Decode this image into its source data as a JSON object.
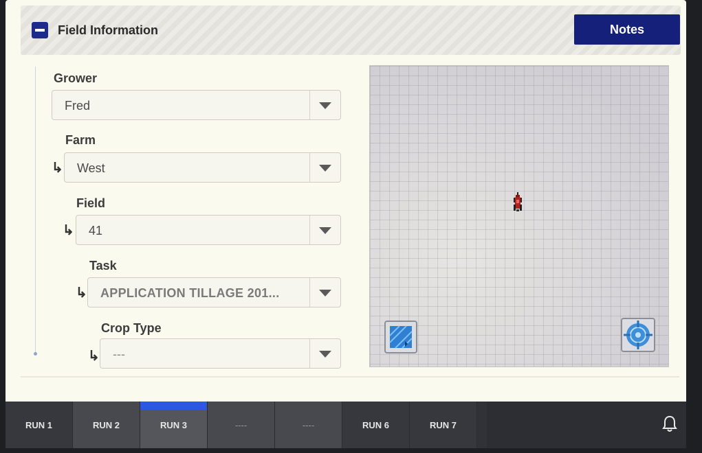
{
  "header": {
    "collapse_icon": "minus-icon",
    "title": "Field Information",
    "notes_label": "Notes"
  },
  "form": {
    "grower": {
      "label": "Grower",
      "value": "Fred"
    },
    "farm": {
      "label": "Farm",
      "value": "West"
    },
    "field": {
      "label": "Field",
      "value": "41"
    },
    "task": {
      "label": "Task",
      "value": "APPLICATION TILLAGE 201..."
    },
    "crop_type": {
      "label": "Crop Type",
      "value": "---"
    },
    "child_arrow": "↳"
  },
  "map": {
    "vehicle_icon": "tractor-icon",
    "left_button_icon": "field-boundary-icon",
    "right_button_icon": "recenter-target-icon"
  },
  "tabs": [
    {
      "label": "RUN 1",
      "active": false
    },
    {
      "label": "RUN 2",
      "active": false
    },
    {
      "label": "RUN 3",
      "active": true
    },
    {
      "label": "----",
      "active": false
    },
    {
      "label": "----",
      "active": false
    },
    {
      "label": "RUN 6",
      "active": false
    },
    {
      "label": "RUN 7",
      "active": false
    }
  ],
  "alerts_icon": "bell-icon",
  "colors": {
    "accent": "#1d2b8c",
    "notes_button": "#15207a",
    "active_tab_indicator": "#2d56e6",
    "background": "#fbfaee"
  }
}
